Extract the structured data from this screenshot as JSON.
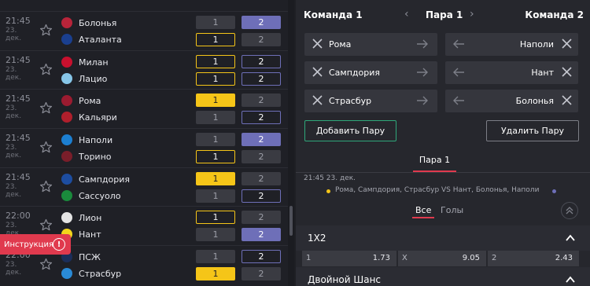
{
  "matches": [
    {
      "time": "21:45",
      "date": "23.\nдек.",
      "home": "Болонья",
      "away": "Аталанта",
      "odds": [
        [
          "1",
          "2"
        ],
        [
          "1",
          "2"
        ]
      ],
      "states": [
        [
          "default",
          "purple"
        ],
        [
          "outline",
          "default"
        ]
      ],
      "crests": [
        "#b8243a",
        "#1a3f8f"
      ]
    },
    {
      "time": "21:45",
      "date": "23.\nдек.",
      "home": "Милан",
      "away": "Лацио",
      "odds": [
        [
          "1",
          "2"
        ],
        [
          "1",
          "2"
        ]
      ],
      "states": [
        [
          "outline",
          "blueoutline"
        ],
        [
          "outline",
          "blueoutline"
        ]
      ],
      "crests": [
        "#c8102e",
        "#87c6e8"
      ]
    },
    {
      "time": "21:45",
      "date": "23.\nдек.",
      "home": "Рома",
      "away": "Кальяри",
      "odds": [
        [
          "1",
          "2"
        ],
        [
          "1",
          "2"
        ]
      ],
      "states": [
        [
          "yellow",
          "default"
        ],
        [
          "default",
          "blueoutline"
        ]
      ],
      "crests": [
        "#9b1b30",
        "#b01f2c"
      ]
    },
    {
      "time": "21:45",
      "date": "23.\nдек.",
      "home": "Наполи",
      "away": "Торино",
      "odds": [
        [
          "1",
          "2"
        ],
        [
          "1",
          "2"
        ]
      ],
      "states": [
        [
          "default",
          "purple"
        ],
        [
          "outline",
          "default"
        ]
      ],
      "crests": [
        "#1c7fd1",
        "#7a1e2a"
      ]
    },
    {
      "time": "21:45",
      "date": "23.\nдек.",
      "home": "Сампдория",
      "away": "Сассуоло",
      "odds": [
        [
          "1",
          "2"
        ],
        [
          "1",
          "2"
        ]
      ],
      "states": [
        [
          "yellow",
          "default"
        ],
        [
          "default",
          "blueoutline"
        ]
      ],
      "crests": [
        "#1d4da0",
        "#1a8a3c"
      ]
    },
    {
      "time": "22:00",
      "date": "23.\nдек.",
      "home": "Лион",
      "away": "Нант",
      "odds": [
        [
          "1",
          "2"
        ],
        [
          "1",
          "2"
        ]
      ],
      "states": [
        [
          "outline",
          "default"
        ],
        [
          "default",
          "purple"
        ]
      ],
      "crests": [
        "#e4e4e4",
        "#f2d51c"
      ]
    },
    {
      "time": "22:00",
      "date": "23.\nдек.",
      "home": "ПСЖ",
      "away": "Страсбур",
      "odds": [
        [
          "1",
          "2"
        ],
        [
          "1",
          "2"
        ]
      ],
      "states": [
        [
          "default",
          "blueoutline"
        ],
        [
          "yellow",
          "default"
        ]
      ],
      "crests": [
        "#1b2e5a",
        "#2a8ad6"
      ]
    }
  ],
  "instruction": {
    "label": "Инструкция",
    "icon": "!"
  },
  "header": {
    "team1": "Команда 1",
    "pair": "Пара 1",
    "team2": "Команда 2",
    "prev": "‹",
    "next": "›"
  },
  "pairs": [
    {
      "left": "Рома",
      "right": "Наполи"
    },
    {
      "left": "Сампдория",
      "right": "Нант"
    },
    {
      "left": "Страсбур",
      "right": "Болонья"
    }
  ],
  "buttons": {
    "add": "Добавить Пару",
    "delete": "Удалить Пару"
  },
  "bet": {
    "tab": "Пара 1",
    "time": "21:45 23. дек.",
    "events": "Рома, Сампдория, Страсбур VS Нант, Болонья, Наполи"
  },
  "market_tabs": {
    "all": "Все",
    "goals": "Голы"
  },
  "market1": {
    "title": "1X2",
    "cells": [
      {
        "label": "1",
        "value": "1.73"
      },
      {
        "label": "X",
        "value": "9.05"
      },
      {
        "label": "2",
        "value": "2.43"
      }
    ]
  },
  "market2": {
    "title": "Двойной Шанс"
  },
  "colors": {
    "accent_yellow": "#f5c518",
    "accent_purple": "#6e6fb8",
    "accent_red": "#e03a4e",
    "accent_green": "#2fa77a"
  }
}
